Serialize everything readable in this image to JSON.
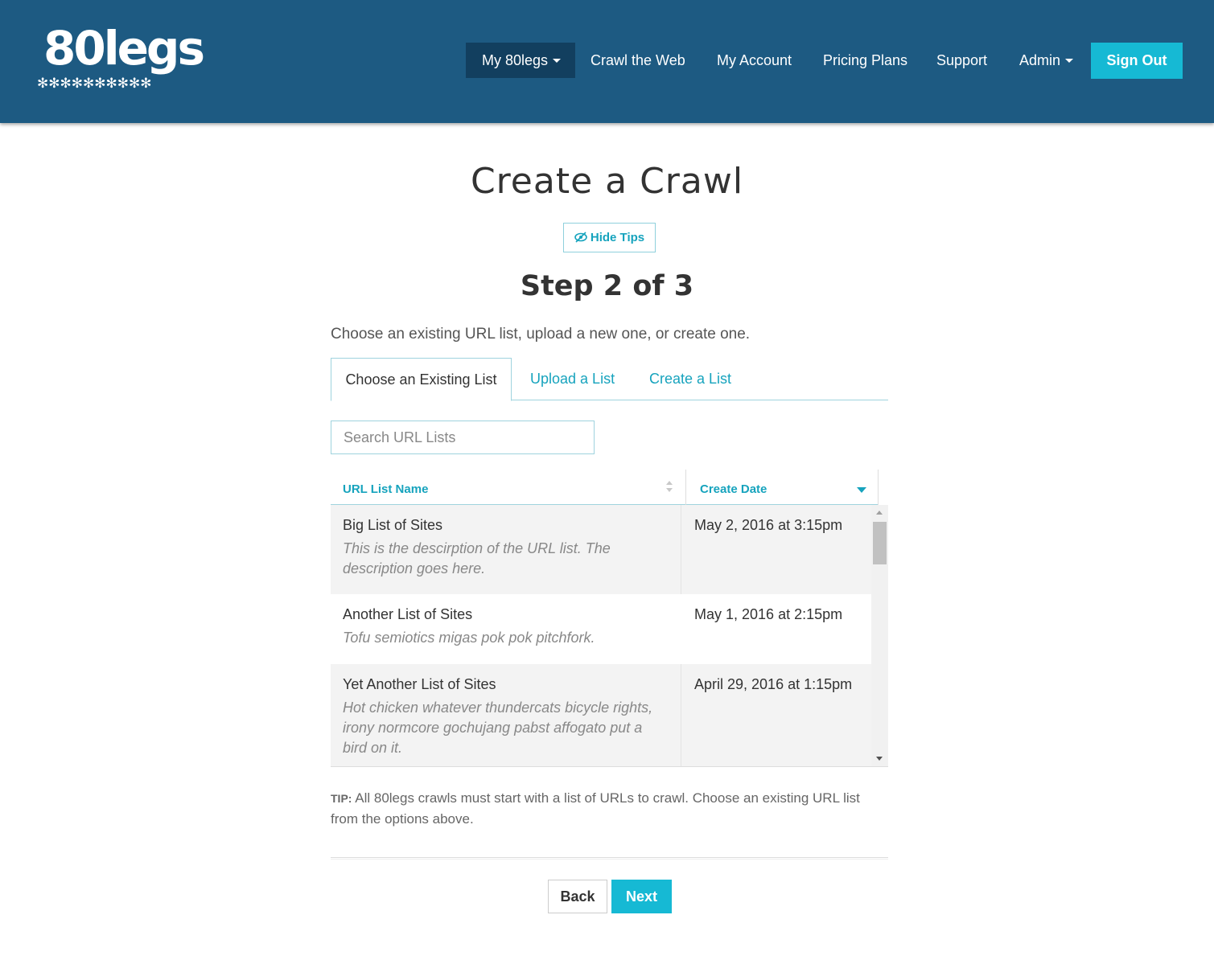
{
  "header": {
    "logo_text": "80legs",
    "logo_legs": "✻✻✻✻✻✻✻✻✻✻",
    "nav": [
      {
        "label": "My 80legs",
        "dropdown": true,
        "active": true
      },
      {
        "label": "Crawl the Web"
      },
      {
        "label": "My Account"
      },
      {
        "label": "Pricing Plans"
      },
      {
        "label": "Support"
      },
      {
        "label": "Admin",
        "dropdown": true
      }
    ],
    "sign_out_label": "Sign Out"
  },
  "main": {
    "title": "Create a Crawl",
    "hide_tips_label": "Hide Tips",
    "step_label": "Step 2 of 3",
    "instructions": "Choose an existing URL list, upload a new one, or create one.",
    "tabs": [
      {
        "label": "Choose an Existing List",
        "active": true
      },
      {
        "label": "Upload a List"
      },
      {
        "label": "Create a List"
      }
    ],
    "search": {
      "placeholder": "Search URL Lists",
      "value": ""
    },
    "table": {
      "columns": [
        "URL List Name",
        "Create Date"
      ],
      "sort": {
        "column": "Create Date",
        "direction": "desc"
      },
      "rows": [
        {
          "name": "Big List of Sites",
          "description": "This is the descirption of the URL list. The description goes here.",
          "date": "May 2, 2016 at 3:15pm"
        },
        {
          "name": "Another List of Sites",
          "description": "Tofu semiotics migas pok pok pitchfork.",
          "date": "May 1, 2016 at 2:15pm"
        },
        {
          "name": "Yet Another List of Sites",
          "description": "Hot chicken whatever thundercats bicycle rights, irony normcore gochujang pabst affogato put a bird on it.",
          "date": "April 29, 2016 at 1:15pm"
        }
      ]
    },
    "tip_label": "TIP:",
    "tip_text": "All 80legs crawls must start with a list of URLs to crawl. Choose an existing URL list from the options above.",
    "back_label": "Back",
    "next_label": "Next"
  },
  "colors": {
    "header_bg": "#1d5a82",
    "nav_active_bg": "#123f5f",
    "accent": "#16b9d4",
    "link": "#16a3bd"
  }
}
